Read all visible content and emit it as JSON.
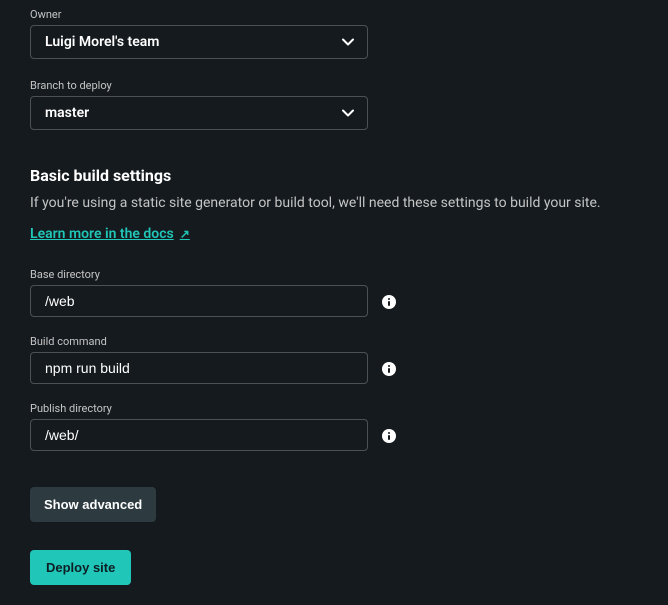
{
  "owner": {
    "label": "Owner",
    "value": "Luigi Morel's team"
  },
  "branch": {
    "label": "Branch to deploy",
    "value": "master"
  },
  "buildSettings": {
    "heading": "Basic build settings",
    "description": "If you're using a static site generator or build tool, we'll need these settings to build your site.",
    "docsLinkText": "Learn more in the docs",
    "docsLinkArrow": "↗"
  },
  "baseDirectory": {
    "label": "Base directory",
    "value": "/web"
  },
  "buildCommand": {
    "label": "Build command",
    "value": "npm run build"
  },
  "publishDirectory": {
    "label": "Publish directory",
    "value": "/web/"
  },
  "buttons": {
    "showAdvanced": "Show advanced",
    "deploySite": "Deploy site"
  }
}
